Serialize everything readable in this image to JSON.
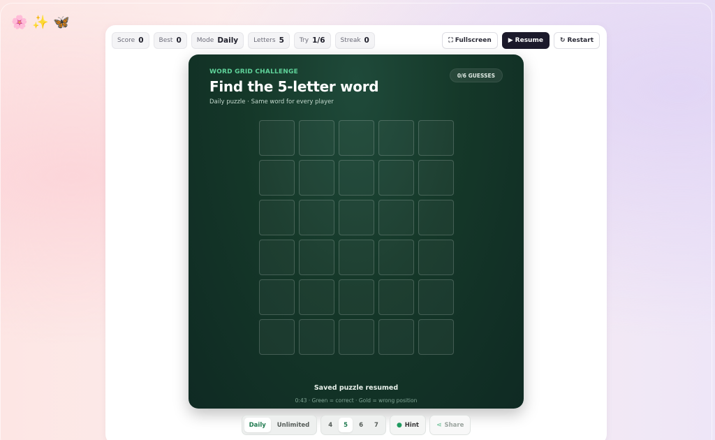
{
  "decor": {
    "emojis": [
      "🌸",
      "✨",
      "🦋"
    ]
  },
  "stats": [
    {
      "label": "Score",
      "value": "0"
    },
    {
      "label": "Best",
      "value": "0"
    },
    {
      "label": "Mode",
      "value": "Daily"
    },
    {
      "label": "Letters",
      "value": "5"
    },
    {
      "label": "Try",
      "value": "1/6"
    },
    {
      "label": "Streak",
      "value": "0"
    }
  ],
  "actions": {
    "fullscreen": {
      "label": "Fullscreen",
      "icon": "fullscreen-icon"
    },
    "resume": {
      "label": "Resume",
      "icon": "play-icon"
    },
    "restart": {
      "label": "Restart",
      "icon": "restart-icon"
    }
  },
  "board": {
    "kicker": "WORD GRID CHALLENGE",
    "title": "Find the 5-letter word",
    "subtitle": "Daily puzzle · Same word for every player",
    "guesses": "0/6 GUESSES",
    "rows": 6,
    "cols": 5,
    "status": "Saved puzzle resumed",
    "legend": "0:43 · Green = correct · Gold = wrong position",
    "colors": {
      "accent": "#5fd39a",
      "bg": "#153829"
    }
  },
  "controls": {
    "modes": [
      {
        "label": "Daily",
        "active": true
      },
      {
        "label": "Unlimited",
        "active": false
      }
    ],
    "lengths": [
      {
        "label": "4",
        "active": false
      },
      {
        "label": "5",
        "active": true
      },
      {
        "label": "6",
        "active": false
      },
      {
        "label": "7",
        "active": false
      }
    ],
    "hint": {
      "label": "Hint",
      "icon": "bulb-icon"
    },
    "share": {
      "label": "Share",
      "icon": "share-icon"
    }
  }
}
